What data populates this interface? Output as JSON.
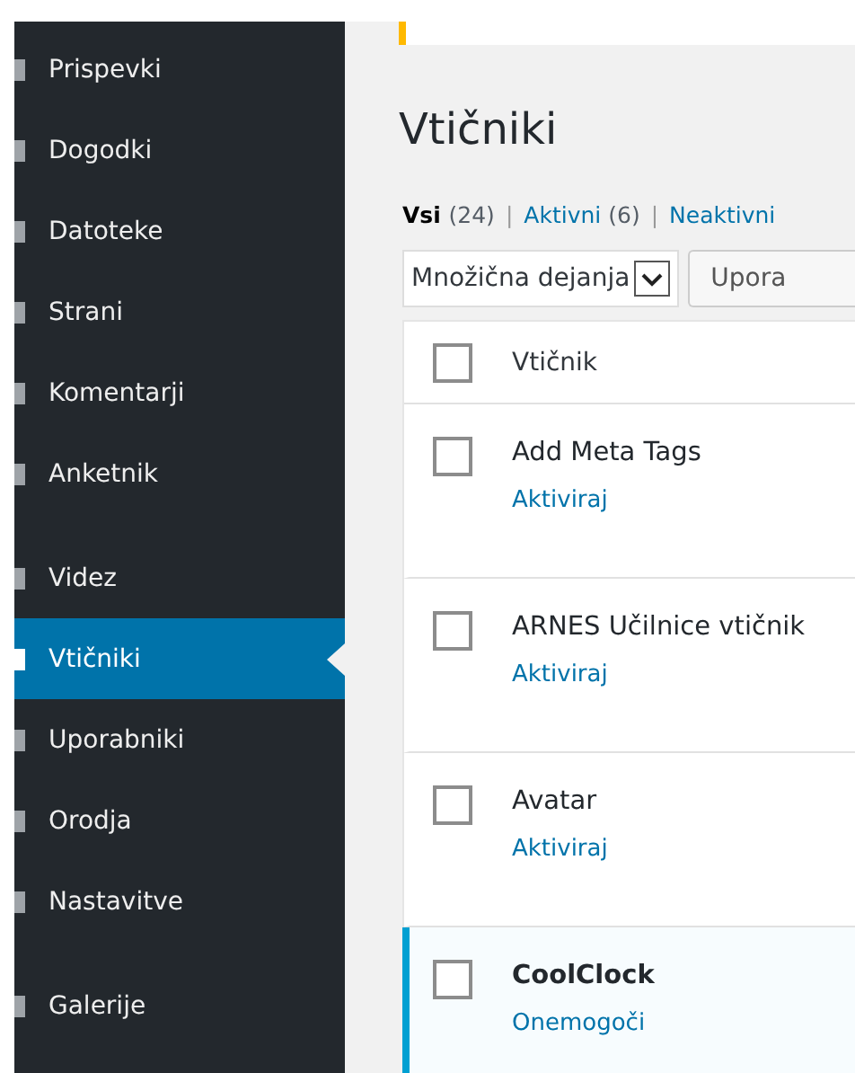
{
  "sidebar": {
    "items": [
      {
        "label": "Prispevki",
        "selected": false,
        "separated_above": false
      },
      {
        "label": "Dogodki",
        "selected": false,
        "separated_above": false
      },
      {
        "label": "Datoteke",
        "selected": false,
        "separated_above": false
      },
      {
        "label": "Strani",
        "selected": false,
        "separated_above": false
      },
      {
        "label": "Komentarji",
        "selected": false,
        "separated_above": false
      },
      {
        "label": "Anketnik",
        "selected": false,
        "separated_above": false
      },
      {
        "label": "Videz",
        "selected": false,
        "separated_above": true
      },
      {
        "label": "Vtičniki",
        "selected": true,
        "separated_above": false
      },
      {
        "label": "Uporabniki",
        "selected": false,
        "separated_above": false
      },
      {
        "label": "Orodja",
        "selected": false,
        "separated_above": false
      },
      {
        "label": "Nastavitve",
        "selected": false,
        "separated_above": false
      },
      {
        "label": "Galerije",
        "selected": false,
        "separated_above": true
      }
    ]
  },
  "page_title": "Vtičniki",
  "filters": [
    {
      "label": "Vsi",
      "count": "(24)",
      "selected": true
    },
    {
      "separator": "|",
      "label": "Aktivni",
      "count": "(6)",
      "selected": false
    },
    {
      "separator": "|",
      "label": "Neaktivni",
      "selected": false
    }
  ],
  "bulk_actions": {
    "value": "Množična dejanja",
    "apply_button": "Upora"
  },
  "table": {
    "header": {
      "label": "Vtičnik",
      "checked": false
    },
    "rows": [
      {
        "name": "Add Meta Tags",
        "action": "Aktiviraj",
        "active": false,
        "checked": false
      },
      {
        "name": "ARNES Učilnice vtičnik",
        "action": "Aktiviraj",
        "active": false,
        "checked": false
      },
      {
        "name": "Avatar",
        "action": "Aktiviraj",
        "active": false,
        "checked": false
      },
      {
        "name": "CoolClock",
        "action": "Onemogoči",
        "active": true,
        "checked": false
      }
    ]
  }
}
